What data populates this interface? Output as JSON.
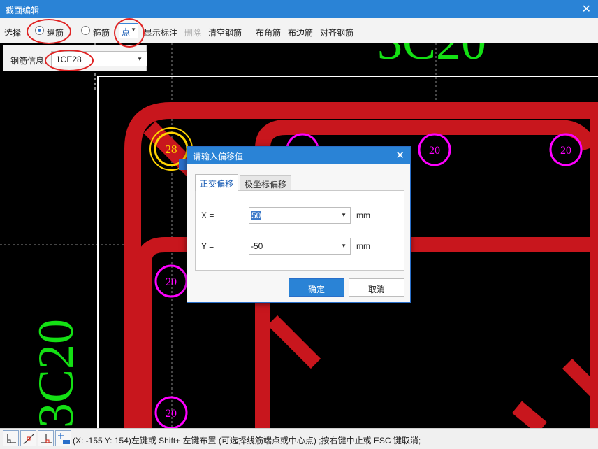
{
  "window": {
    "title": "截面编辑",
    "close_glyph": "✕"
  },
  "toolbar": {
    "select_label": "选择",
    "longitudinal_label": "纵筋",
    "stirrup_label": "箍筋",
    "point_mode": "点",
    "show_annotation": "显示标注",
    "delete": "删除",
    "clear_rebar": "清空钢筋",
    "corner_rebar": "布角筋",
    "edge_rebar": "布边筋",
    "align_rebar": "对齐钢筋"
  },
  "info_panel": {
    "label": "钢筋信息:",
    "value": "1CE28"
  },
  "canvas": {
    "large_label": "3C20",
    "corner_bar_label": "28",
    "bar_labels": [
      "20",
      "20",
      "20",
      "20",
      "20"
    ],
    "colors": {
      "background": "#000000",
      "section": "#c8161d",
      "bar_ring": "#ff00ff",
      "corner_ring": "#ffd400",
      "label_green": "#14e014",
      "outline": "#ffffff"
    }
  },
  "dialog": {
    "title": "请输入偏移值",
    "close_glyph": "✕",
    "tabs": [
      "正交偏移",
      "极坐标偏移"
    ],
    "x_label": "X =",
    "x_value": "50",
    "y_label": "Y =",
    "y_value": "-50",
    "unit": "mm",
    "ok": "确定",
    "cancel": "取消"
  },
  "status": {
    "text": "(X: -155 Y: 154)左键或 Shift+ 左键布置 (可选择线筋端点或中心点) ;按右键中止或 ESC 键取消;"
  }
}
